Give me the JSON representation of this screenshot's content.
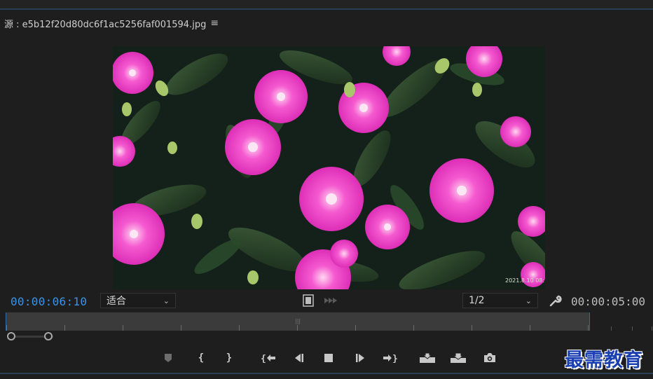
{
  "panel": {
    "title": "源 : e5b12f20d80dc6f1ac5256faf001594.jpg",
    "menu_icon": "≡"
  },
  "viewer": {
    "image_alt": "pink flowers with green leaves",
    "image_timestamp": "2021.8.10 08:10"
  },
  "controls": {
    "current_timecode": "00:00:06:10",
    "fit_value": "适合",
    "resolution_value": "1/2",
    "duration_timecode": "00:00:05:00",
    "icons": {
      "export_frame": "film-icon",
      "insert": "fast-forward-icon",
      "settings": "wrench-icon"
    }
  },
  "colors": {
    "accent_blue": "#3a93e8",
    "panel_bg": "#1e1e1e",
    "timeline_bg": "#3b3b3b",
    "watermark_blue": "#1a3fb0"
  },
  "transport": {
    "buttons": [
      {
        "name": "add-marker-button",
        "icon": "marker-icon"
      },
      {
        "name": "mark-in-button",
        "icon": "mark-in-icon",
        "glyph": "{"
      },
      {
        "name": "mark-out-button",
        "icon": "mark-out-icon",
        "glyph": "}"
      },
      {
        "name": "go-to-in-button",
        "icon": "go-to-in-icon"
      },
      {
        "name": "step-back-button",
        "icon": "step-back-icon"
      },
      {
        "name": "stop-button",
        "icon": "stop-icon"
      },
      {
        "name": "step-forward-button",
        "icon": "step-forward-icon"
      },
      {
        "name": "go-to-out-button",
        "icon": "go-to-out-icon"
      },
      {
        "name": "insert-button",
        "icon": "insert-icon"
      },
      {
        "name": "overwrite-button",
        "icon": "overwrite-icon"
      },
      {
        "name": "export-frame-button",
        "icon": "camera-icon"
      }
    ]
  },
  "watermark": {
    "text": "最需教育"
  }
}
